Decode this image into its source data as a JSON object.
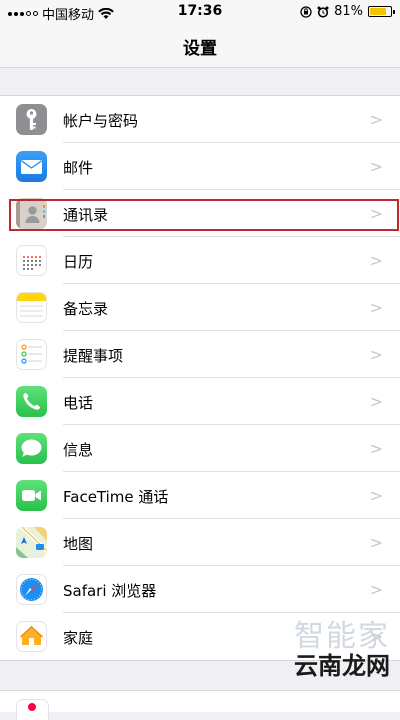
{
  "status_bar": {
    "carrier": "中国移动",
    "time": "17:36",
    "battery": "81%",
    "battery_level": 0.81,
    "icons": [
      "signal-dots-icon",
      "wifi-icon",
      "orientation-lock-icon",
      "alarm-icon",
      "battery-icon"
    ]
  },
  "nav": {
    "title": "设置"
  },
  "settings": {
    "items": [
      {
        "label": "帐户与密码",
        "icon": "key-icon",
        "color": "#8e8e93"
      },
      {
        "label": "邮件",
        "icon": "mail-icon",
        "color": "#1f8ef1"
      },
      {
        "label": "通讯录",
        "icon": "contacts-icon",
        "color": "#b9b4ab"
      },
      {
        "label": "日历",
        "icon": "calendar-icon",
        "color": "#ffffff"
      },
      {
        "label": "备忘录",
        "icon": "notes-icon",
        "color": "#ffffff"
      },
      {
        "label": "提醒事项",
        "icon": "reminders-icon",
        "color": "#ffffff"
      },
      {
        "label": "电话",
        "icon": "phone-icon",
        "color": "#34c759"
      },
      {
        "label": "信息",
        "icon": "messages-icon",
        "color": "#34c759"
      },
      {
        "label": "FaceTime 通话",
        "icon": "facetime-icon",
        "color": "#34c759"
      },
      {
        "label": "地图",
        "icon": "maps-icon",
        "color": "#5fbf72"
      },
      {
        "label": "Safari 浏览器",
        "icon": "safari-icon",
        "color": "#ffffff"
      },
      {
        "label": "家庭",
        "icon": "home-icon",
        "color": "#ffffff"
      }
    ]
  },
  "highlight_color": "#c0282d",
  "watermark": {
    "top": "智能家",
    "bottom": "云南龙网"
  }
}
